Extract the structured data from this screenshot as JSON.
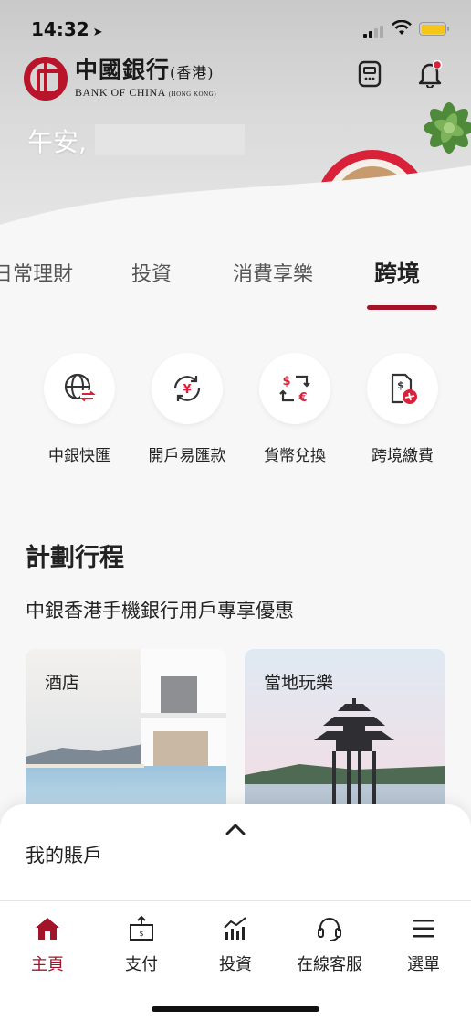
{
  "status": {
    "time": "14:32"
  },
  "brand": {
    "name_cn": "中國銀行",
    "name_cn_suffix": "(香港)",
    "name_en": "BANK OF CHINA",
    "name_en_suffix": "(HONG KONG)",
    "color": "#b8142a"
  },
  "header": {
    "greeting": "午安,"
  },
  "tabs": [
    {
      "label": "日常理財"
    },
    {
      "label": "投資"
    },
    {
      "label": "消費享樂"
    },
    {
      "label": "跨境",
      "active": true
    }
  ],
  "quick_actions": [
    {
      "label": "中銀快匯",
      "icon": "globe-transfer-icon"
    },
    {
      "label": "開戶易匯款",
      "icon": "yen-exchange-icon"
    },
    {
      "label": "貨幣兌換",
      "icon": "currency-exchange-icon"
    },
    {
      "label": "跨境繳費",
      "icon": "bill-plane-icon"
    }
  ],
  "plan": {
    "title": "計劃行程",
    "subtitle": "中銀香港手機銀行用戶專享優惠",
    "cards": [
      {
        "label": "酒店"
      },
      {
        "label": "當地玩樂"
      }
    ]
  },
  "account": {
    "title": "我的賬戶"
  },
  "nav": [
    {
      "label": "主頁",
      "icon": "home-icon",
      "active": true
    },
    {
      "label": "支付",
      "icon": "payment-icon"
    },
    {
      "label": "投資",
      "icon": "invest-chart-icon"
    },
    {
      "label": "在線客服",
      "icon": "headset-icon"
    },
    {
      "label": "選單",
      "icon": "menu-icon"
    }
  ],
  "colors": {
    "accent": "#a3142a",
    "background": "#f7f7f7"
  }
}
